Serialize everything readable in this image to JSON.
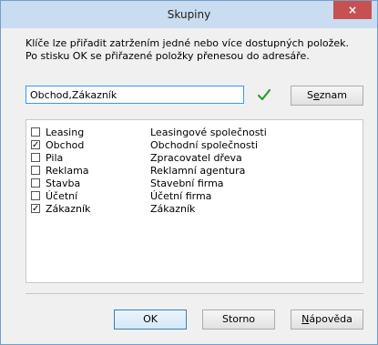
{
  "window": {
    "title": "Skupiny",
    "close_label": "×"
  },
  "description": [
    "Klíče lze přiřadit zatržením jedné nebo více dostupných položek.",
    "Po stisku OK se přiřazené položky přenesou do adresáře."
  ],
  "input": {
    "value": "Obchod,Zákazník"
  },
  "buttons": {
    "seznam_pre": "S",
    "seznam_u": "e",
    "seznam_post": "znam",
    "ok": "OK",
    "storno": "Storno",
    "napoveda_u": "N",
    "napoveda_post": "ápověda"
  },
  "items": [
    {
      "name": "Leasing",
      "desc": "Leasingové společnosti",
      "checked": false
    },
    {
      "name": "Obchod",
      "desc": "Obchodní společnosti",
      "checked": true
    },
    {
      "name": "Pila",
      "desc": "Zpracovatel dřeva",
      "checked": false
    },
    {
      "name": "Reklama",
      "desc": "Reklamní agentura",
      "checked": false
    },
    {
      "name": "Stavba",
      "desc": "Stavební firma",
      "checked": false
    },
    {
      "name": "Účetní",
      "desc": "Účetní firma",
      "checked": false
    },
    {
      "name": "Zákazník",
      "desc": "Zákazník",
      "checked": true
    }
  ],
  "colors": {
    "accent": "#3399ff",
    "check_green": "#2e9a2e",
    "close_red": "#c75050"
  }
}
